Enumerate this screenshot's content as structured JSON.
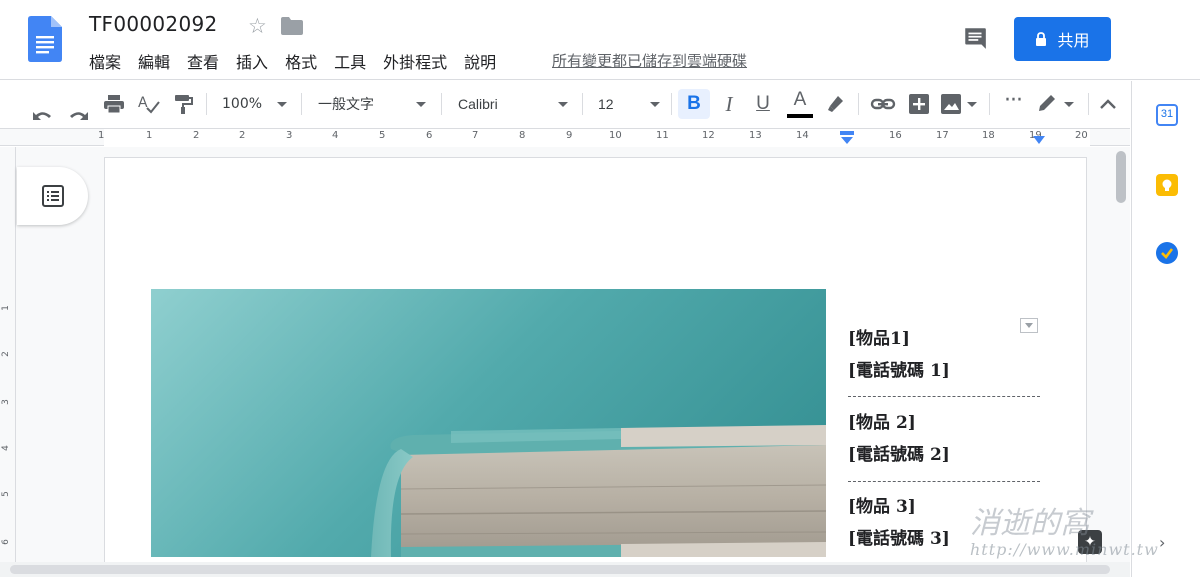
{
  "app": {
    "doc_title": "TF00002092",
    "menu": [
      "檔案",
      "編輯",
      "查看",
      "插入",
      "格式",
      "工具",
      "外掛程式",
      "說明"
    ],
    "save_status": "所有變更都已儲存到雲端硬碟",
    "share_label": "共用",
    "colors": {
      "accent": "#1a73e8",
      "docs_blue": "#4285f4",
      "teal": "#3b9ea0"
    }
  },
  "toolbar": {
    "zoom": "100%",
    "style": "一般文字",
    "font": "Calibri",
    "size": "12",
    "bold_active": true
  },
  "ruler": {
    "labels": [
      "1",
      "1",
      "2",
      "3",
      "4",
      "5",
      "6",
      "7",
      "8",
      "9",
      "10",
      "11",
      "12",
      "13",
      "14",
      "15",
      "16",
      "17",
      "18",
      "19",
      "20"
    ]
  },
  "vruler": {
    "labels": [
      "1",
      "2",
      "3",
      "4",
      "5",
      "6"
    ]
  },
  "document": {
    "entries": [
      {
        "item": "[物品1]",
        "phone": "[電話號碼 1]"
      },
      {
        "item": "[物品 2]",
        "phone": "[電話號碼 2]"
      },
      {
        "item": "[物品 3]",
        "phone": "[電話號碼 3]"
      }
    ]
  },
  "icons": {
    "logo": "docs-logo-icon",
    "calendar_text": "31"
  },
  "watermark": {
    "line1": "消逝的窩",
    "line2": "http://www.minwt.tw"
  }
}
